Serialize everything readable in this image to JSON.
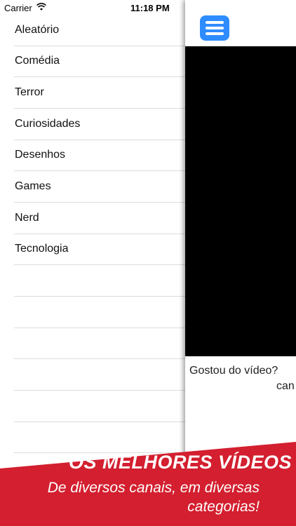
{
  "status_bar": {
    "carrier": "Carrier",
    "time": "11:18 PM"
  },
  "menu": {
    "items": [
      {
        "label": "Aleatório"
      },
      {
        "label": "Comédia"
      },
      {
        "label": "Terror"
      },
      {
        "label": "Curiosidades"
      },
      {
        "label": "Desenhos"
      },
      {
        "label": "Games"
      },
      {
        "label": "Nerd"
      },
      {
        "label": "Tecnologia"
      }
    ]
  },
  "panel": {
    "caption_line1": "Gostou do vídeo?",
    "caption_line2": "can"
  },
  "promo": {
    "title": "OS MELHORES VÍDEOS",
    "subtitle": "De diversos canais, em diversas categorias!"
  },
  "colors": {
    "accent": "#2f8cff",
    "banner": "#d31f2f"
  },
  "icons": {
    "menu": "hamburger-icon",
    "wifi": "wifi-icon",
    "battery": "battery-icon"
  }
}
